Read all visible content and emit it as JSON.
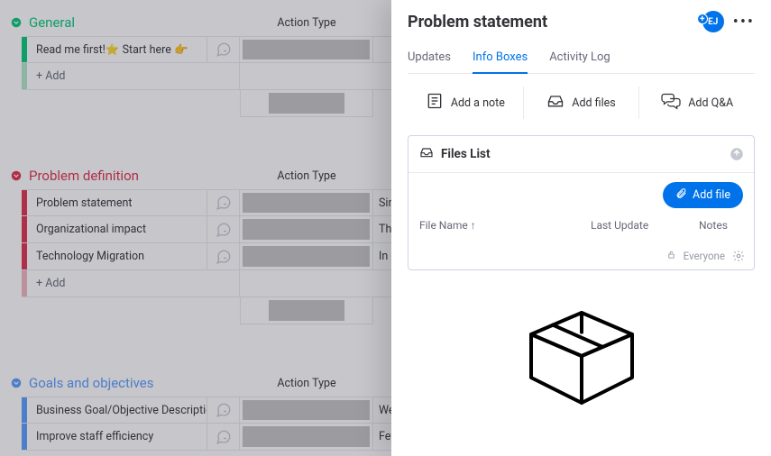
{
  "board": {
    "groups": [
      {
        "title": "General",
        "color": "#00c875",
        "caret": "down",
        "action_header": "Action Type",
        "rows": [
          {
            "name": "Read me first!⭐ Start here 👉",
            "color": "#00c875",
            "action_fill": true,
            "extra": ""
          }
        ],
        "show_add": true,
        "add_label": "+ Add",
        "add_color": "#b2e8c7",
        "show_summary": true
      },
      {
        "title": "Problem definition",
        "color": "#df2f4a",
        "caret": "down",
        "action_header": "Action Type",
        "rows": [
          {
            "name": "Problem statement",
            "color": "#df2f4a",
            "action_fill": true,
            "extra": "Sin"
          },
          {
            "name": "Organizational impact",
            "color": "#df2f4a",
            "action_fill": true,
            "extra": "The"
          },
          {
            "name": "Technology Migration",
            "color": "#df2f4a",
            "action_fill": true,
            "extra": "In o"
          }
        ],
        "show_add": true,
        "add_label": "+ Add",
        "add_color": "#f2b6bf",
        "show_summary": true
      },
      {
        "title": "Goals and objectives",
        "color": "#579bfc",
        "caret": "down",
        "action_header": "Action Type",
        "rows": [
          {
            "name": "Business Goal/Objective Description T…",
            "color": "#579bfc",
            "action_fill": true,
            "extra": "We"
          },
          {
            "name": "Improve staff efficiency",
            "color": "#579bfc",
            "action_fill": true,
            "extra": "Few"
          }
        ],
        "show_add": false,
        "add_label": "+ Add",
        "add_color": "#b9d4fd",
        "show_summary": false
      }
    ]
  },
  "panel": {
    "title": "Problem statement",
    "avatar_initials": "EJ",
    "tabs": [
      {
        "label": "Updates",
        "active": false
      },
      {
        "label": "Info Boxes",
        "active": true
      },
      {
        "label": "Activity Log",
        "active": false
      }
    ],
    "actions": {
      "note": "Add a note",
      "files": "Add files",
      "qa": "Add Q&A"
    },
    "files": {
      "title": "Files List",
      "add_button": "Add file",
      "col_name": "File Name",
      "col_update": "Last Update",
      "col_notes": "Notes",
      "visibility": "Everyone"
    }
  }
}
